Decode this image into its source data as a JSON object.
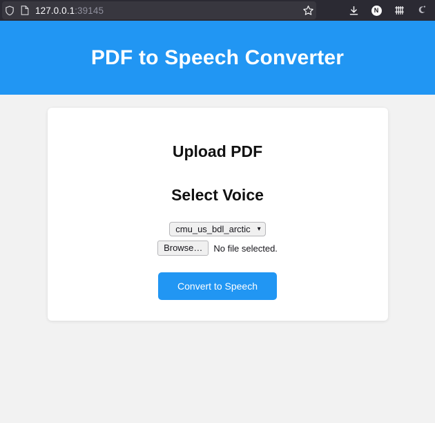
{
  "browser": {
    "urlbar": {
      "shield_icon": "shield-icon",
      "page_icon": "page-icon",
      "host": "127.0.0.1",
      "port": ":39145"
    },
    "bookmark_icon": "star-icon",
    "actions": [
      {
        "name": "downloads-icon",
        "label": ""
      },
      {
        "name": "account-icon",
        "label": "N"
      },
      {
        "name": "extensions-grid-icon",
        "label": ""
      },
      {
        "name": "extension-icon",
        "label": ""
      }
    ]
  },
  "page": {
    "banner": {
      "title": "PDF to Speech Converter",
      "background": "#2196f3",
      "text_color": "#ffffff"
    },
    "card": {
      "upload_heading": "Upload PDF",
      "voice_heading": "Select Voice",
      "voice_select": {
        "selected": "cmu_us_bdl_arctic",
        "chevron": "⌄"
      },
      "file_input": {
        "browse_label": "Browse…",
        "status": "No file selected."
      },
      "submit_label": "Convert to Speech",
      "submit_color": "#2196f3"
    },
    "background": "#f2f2f2"
  }
}
